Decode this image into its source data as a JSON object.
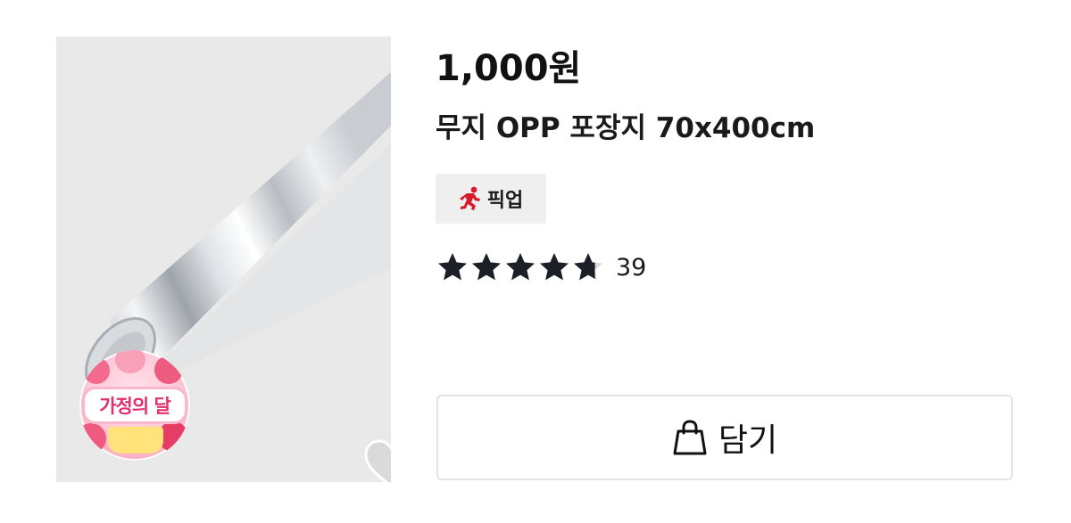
{
  "product": {
    "price": "1,000원",
    "title": "무지 OPP 포장지 70x400cm",
    "promo_badge": "가정의 달",
    "pickup_label": "픽업",
    "rating": {
      "value": 4.7,
      "max": 5,
      "review_count": "39"
    },
    "add_button_label": "담기"
  },
  "colors": {
    "pickup_icon": "#d81b2d",
    "star": "#1c1f26",
    "promo_text": "#e0306d",
    "image_bg": "#e9e9e9"
  },
  "icons": {
    "pickup": "running-person-icon",
    "wishlist": "heart-icon",
    "cart": "shopping-bag-icon"
  }
}
